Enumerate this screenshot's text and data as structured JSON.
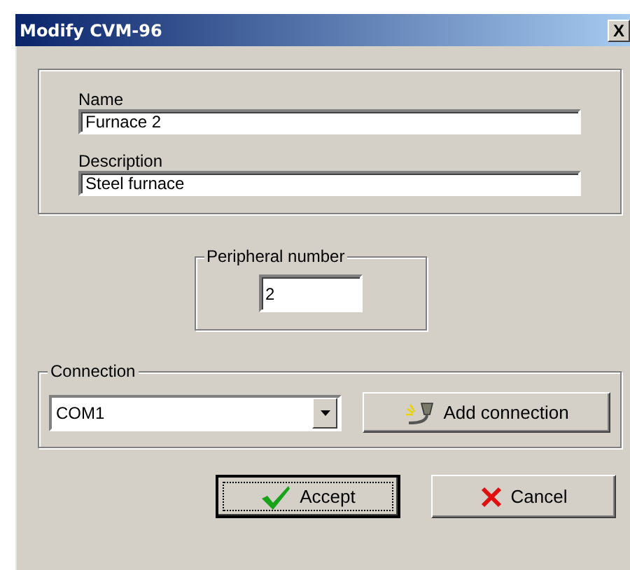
{
  "window": {
    "title": "Modify CVM-96",
    "close": "X"
  },
  "fields": [
    {
      "label": "Name",
      "value": "Furnace 2"
    },
    {
      "label": "Description",
      "value": "Steel furnace"
    }
  ],
  "peripheral": {
    "legend": "Peripheral number",
    "value": "2"
  },
  "connection": {
    "legend": "Connection",
    "value": "COM1",
    "button": "Add connection"
  },
  "buttons": [
    {
      "label": "Accept",
      "kind": "accept",
      "default": true
    },
    {
      "label": "Cancel",
      "kind": "cancel",
      "default": false
    }
  ]
}
